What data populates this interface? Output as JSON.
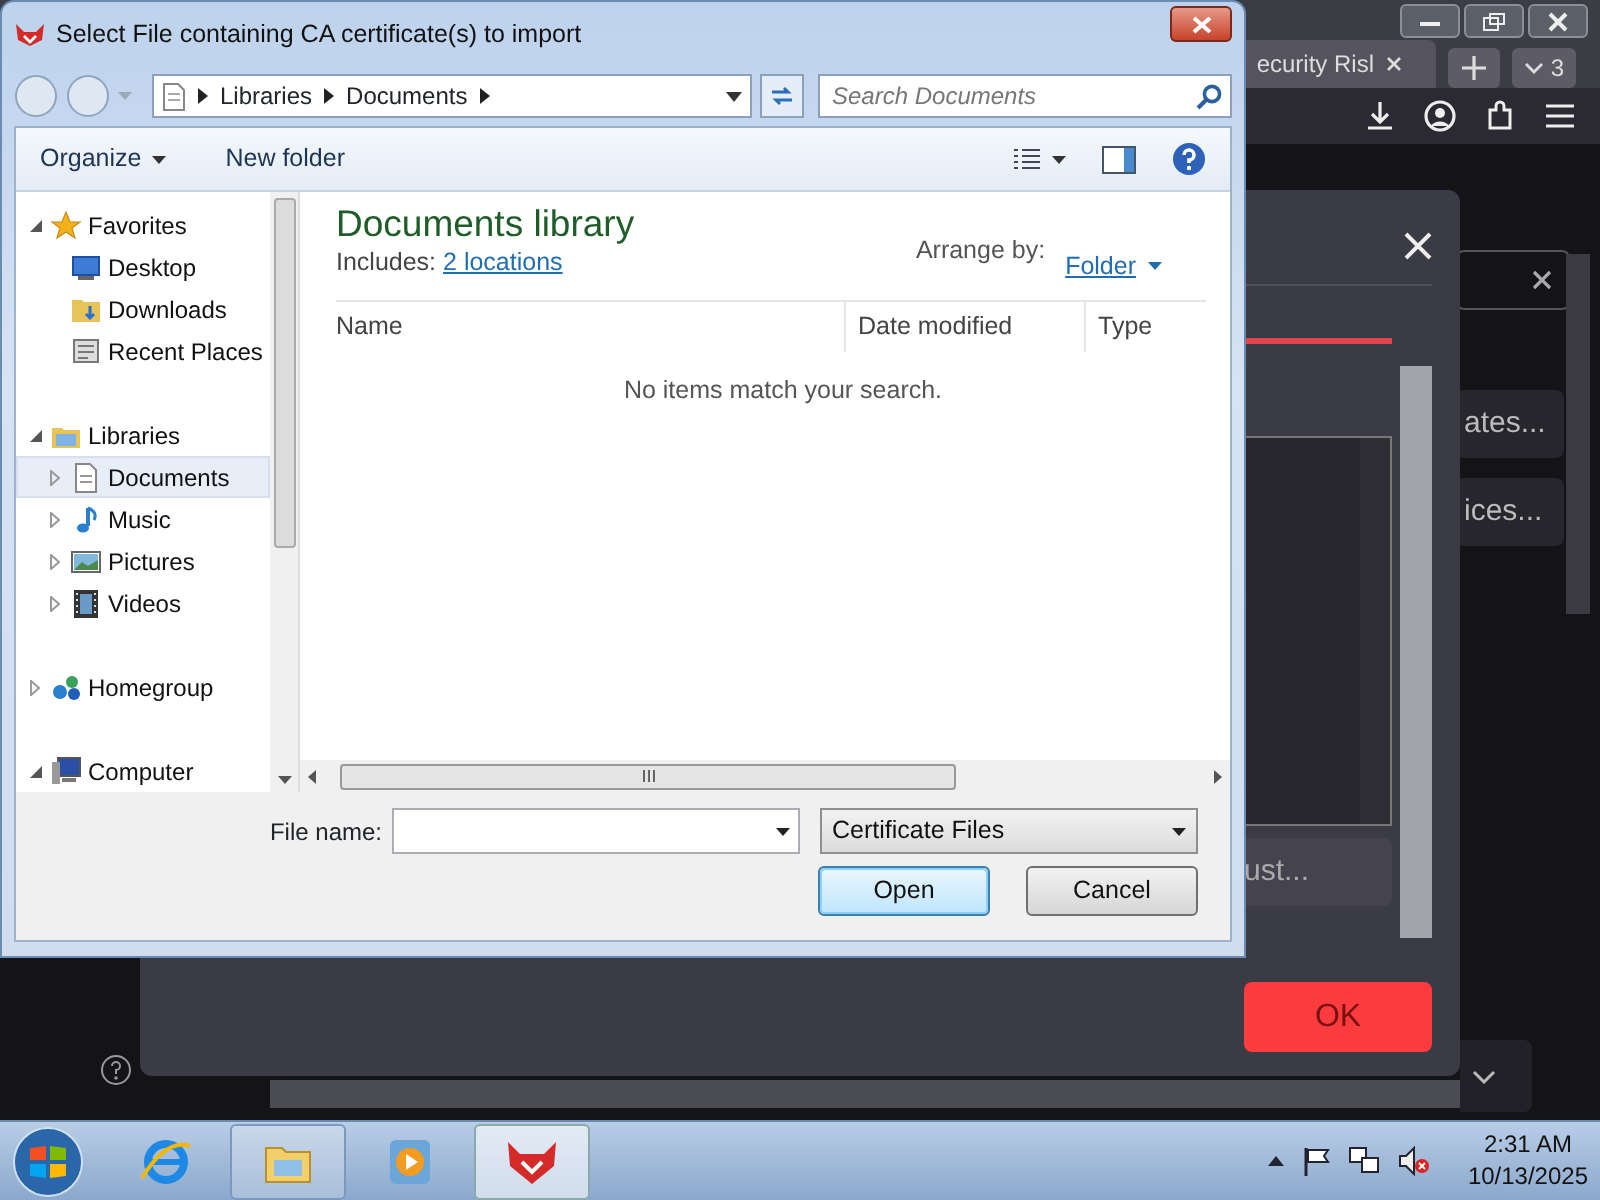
{
  "browser": {
    "tab": {
      "title": "ecurity Risl"
    },
    "tab_count": "3",
    "content_buttons": [
      "ates...",
      "ices..."
    ]
  },
  "settings_dialog": {
    "partial_button": "ust...",
    "ok_button": "OK"
  },
  "file_dialog": {
    "title": "Select File containing CA certificate(s) to import",
    "path": [
      "Libraries",
      "Documents"
    ],
    "search": {
      "placeholder": "Search Documents"
    },
    "toolbar": [
      {
        "label": "Organize",
        "dropdown": true
      },
      {
        "label": "New folder",
        "dropdown": false
      }
    ],
    "tree": [
      {
        "label": "Favorites",
        "kind": "star",
        "expanded": true,
        "selected": false,
        "children": [
          {
            "label": "Desktop",
            "kind": "desktop",
            "selected": false
          },
          {
            "label": "Downloads",
            "kind": "downloads",
            "selected": false
          },
          {
            "label": "Recent Places",
            "kind": "recent",
            "selected": false
          }
        ]
      },
      {
        "label": "Libraries",
        "kind": "library",
        "expanded": true,
        "selected": false,
        "children": [
          {
            "label": "Documents",
            "kind": "documents",
            "expanded": false,
            "selected": true
          },
          {
            "label": "Music",
            "kind": "music",
            "expanded": false,
            "selected": false
          },
          {
            "label": "Pictures",
            "kind": "pictures",
            "expanded": false,
            "selected": false
          },
          {
            "label": "Videos",
            "kind": "videos",
            "expanded": false,
            "selected": false
          }
        ]
      },
      {
        "label": "Homegroup",
        "kind": "homegroup",
        "expanded": false,
        "selected": false
      },
      {
        "label": "Computer",
        "kind": "computer",
        "expanded": true,
        "selected": false
      }
    ],
    "library": {
      "title": "Documents library",
      "includes_label": "Includes:",
      "includes_link": "2 locations",
      "arrange_label": "Arrange by:",
      "arrange_value": "Folder"
    },
    "columns": [
      "Name",
      "Date modified",
      "Type"
    ],
    "empty_message": "No items match your search.",
    "file_name_label": "File name:",
    "file_type": "Certificate Files",
    "buttons": [
      {
        "label": "Open",
        "default": true
      },
      {
        "label": "Cancel",
        "default": false
      }
    ]
  },
  "taskbar": {
    "apps": [
      {
        "kind": "ie",
        "running": false,
        "active": false
      },
      {
        "kind": "explorer",
        "running": true,
        "active": false
      },
      {
        "kind": "media",
        "running": false,
        "active": false
      },
      {
        "kind": "redapp",
        "running": true,
        "active": true
      }
    ],
    "clock": {
      "time": "2:31 AM",
      "date": "10/13/2025"
    }
  }
}
